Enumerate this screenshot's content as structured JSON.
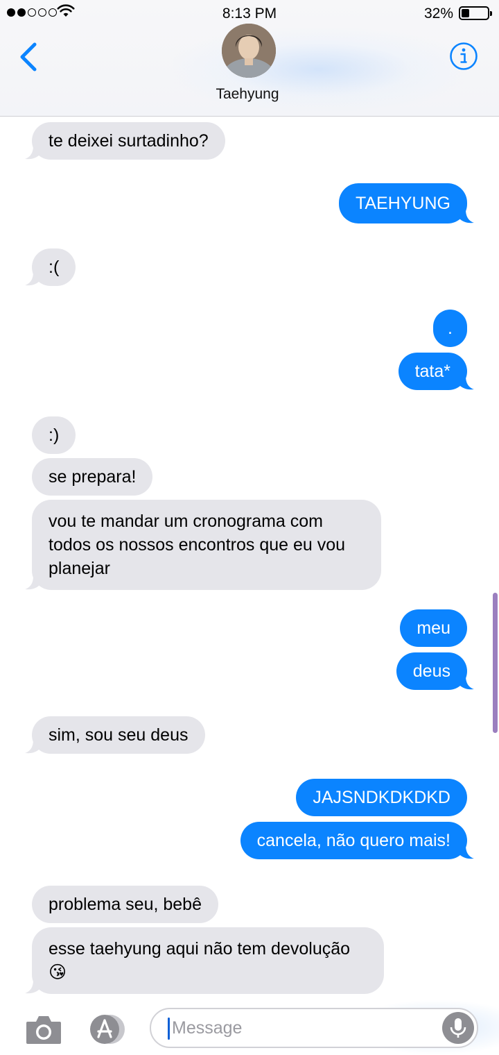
{
  "status_bar": {
    "time": "8:13 PM",
    "battery_percent": "32%",
    "signal_bars_filled": 2,
    "signal_bars_total": 5,
    "battery_level": 0.32,
    "icons": [
      "signal-icon",
      "wifi-icon",
      "battery-icon"
    ]
  },
  "header": {
    "contact_name": "Taehyung",
    "back_icon": "chevron-left-icon",
    "info_icon": "info-icon",
    "accent_color": "#0b84ff"
  },
  "messages": [
    {
      "dir": "in",
      "text": "te deixei surtadinho?"
    },
    {
      "dir": "out",
      "text": "TAEHYUNG"
    },
    {
      "dir": "in",
      "text": ":("
    },
    {
      "dir": "out",
      "text": "."
    },
    {
      "dir": "out",
      "text": "tata*"
    },
    {
      "dir": "in",
      "text": ":)"
    },
    {
      "dir": "in",
      "text": "se prepara!"
    },
    {
      "dir": "in",
      "text": "vou te mandar um cronograma com todos os nossos encontros que eu vou planejar"
    },
    {
      "dir": "out",
      "text": "meu"
    },
    {
      "dir": "out",
      "text": "deus"
    },
    {
      "dir": "in",
      "text": "sim, sou seu deus"
    },
    {
      "dir": "out",
      "text": "JAJSNDKDKDKD"
    },
    {
      "dir": "out",
      "text": "cancela, não quero mais!"
    },
    {
      "dir": "in",
      "text": "problema seu, bebê"
    },
    {
      "dir": "in",
      "text": "esse taehyung aqui não tem devolução 😘"
    }
  ],
  "colors": {
    "incoming_bubble": "#e5e5ea",
    "outgoing_bubble": "#0b84ff"
  },
  "input_bar": {
    "placeholder": "Message",
    "camera_icon": "camera-icon",
    "appstore_icon": "app-store-icon",
    "mic_icon": "microphone-icon"
  }
}
